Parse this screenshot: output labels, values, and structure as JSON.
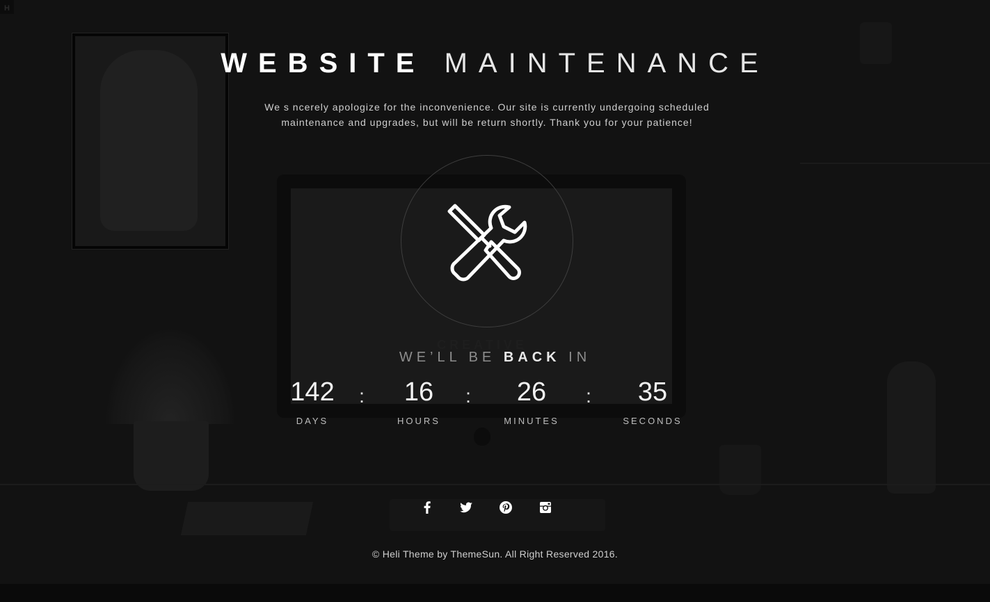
{
  "title": {
    "bold": "WEBSITE",
    "light": "MAINTENANCE"
  },
  "description": "We s ncerely apologize for the inconvenience. Our site is currently undergoing scheduled maintenance and upgrades, but will be return shortly. Thank you for your patience!",
  "icon": "tools-icon",
  "back_in": {
    "pre": "WE’LL BE",
    "bold": "BACK",
    "post": "IN"
  },
  "countdown": {
    "days": {
      "value": "142",
      "label": "DAYS"
    },
    "hours": {
      "value": "16",
      "label": "HOURS"
    },
    "minutes": {
      "value": "26",
      "label": "MINUTES"
    },
    "seconds": {
      "value": "35",
      "label": "SECONDS"
    },
    "separator": ":"
  },
  "social": [
    "facebook-icon",
    "twitter-icon",
    "pinterest-icon",
    "instagram-icon"
  ],
  "footer": "© Heli Theme by ThemeSun. All Right Reserved 2016.",
  "background": {
    "ghost_text": "CREATIVE",
    "monitor_logo": "H"
  },
  "colors": {
    "background": "#121212",
    "text": "#ffffff",
    "muted": "#8d8d8d",
    "circle": "#3e3e3e"
  }
}
